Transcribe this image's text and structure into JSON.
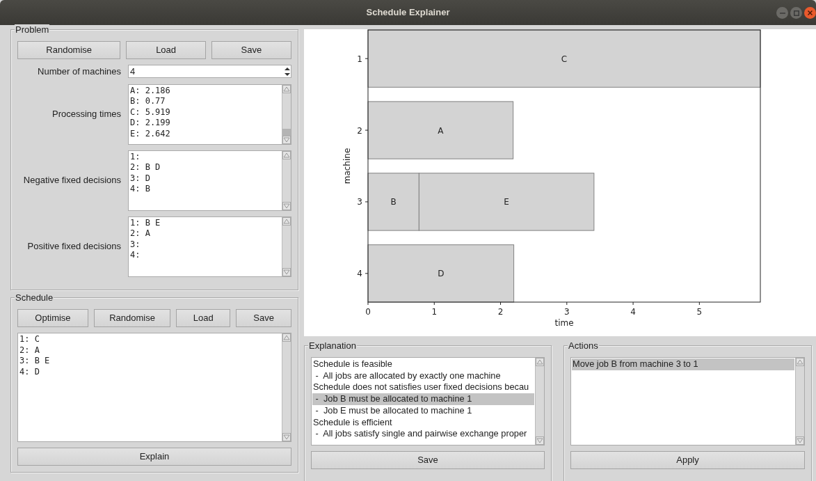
{
  "window": {
    "title": "Schedule Explainer"
  },
  "problem": {
    "title": "Problem",
    "buttons": [
      "Randomise",
      "Load",
      "Save"
    ],
    "machines": {
      "label": "Number of machines",
      "value": "4"
    },
    "fields": [
      {
        "label": "Processing times",
        "lines": [
          "A: 2.186",
          "B: 0.77",
          "C: 5.919",
          "D: 2.199",
          "E: 2.642"
        ]
      },
      {
        "label": "Negative fixed decisions",
        "lines": [
          "1:",
          "2: B D",
          "3: D",
          "4: B"
        ]
      },
      {
        "label": "Positive fixed decisions",
        "lines": [
          "1: B E",
          "2: A",
          "3:",
          "4:"
        ]
      }
    ]
  },
  "schedule": {
    "title": "Schedule",
    "buttons": [
      "Optimise",
      "Randomise",
      "Load",
      "Save"
    ],
    "lines": [
      "1: C",
      "2: A",
      "3: B E",
      "4: D"
    ],
    "action": "Explain"
  },
  "chart": {
    "chart_data": {
      "type": "bar",
      "orientation": "horizontal",
      "stacked": true,
      "xlabel": "time",
      "ylabel": "machine",
      "categories": [
        "1",
        "2",
        "3",
        "4"
      ],
      "xlim": [
        0,
        5.92
      ],
      "xticks": [
        0,
        1,
        2,
        3,
        4,
        5
      ],
      "series": [
        {
          "name": "A",
          "color": "#d3d3d3",
          "values": [
            null,
            2.19,
            null,
            null
          ]
        },
        {
          "name": "B",
          "color": "#d3d3d3",
          "values": [
            null,
            null,
            0.77,
            null
          ]
        },
        {
          "name": "C",
          "color": "#d3d3d3",
          "values": [
            5.92,
            null,
            null,
            null
          ]
        },
        {
          "name": "D",
          "color": "#d3d3d3",
          "values": [
            null,
            null,
            null,
            2.2
          ]
        },
        {
          "name": "E",
          "color": "#d3d3d3",
          "values": [
            null,
            null,
            2.64,
            null
          ]
        }
      ]
    }
  },
  "explanation": {
    "title": "Explanation",
    "items": [
      {
        "text": "Schedule is feasible",
        "selected": false
      },
      {
        "text": " -  All jobs are allocated by exactly one machine",
        "selected": false
      },
      {
        "text": "Schedule does not satisfies user fixed decisions becau",
        "selected": false
      },
      {
        "text": " -  Job B must be allocated to machine 1",
        "selected": true
      },
      {
        "text": " -  Job E must be allocated to machine 1",
        "selected": false
      },
      {
        "text": "Schedule is efficient",
        "selected": false
      },
      {
        "text": " -  All jobs satisfy single and pairwise exchange proper",
        "selected": false
      }
    ],
    "button": "Save"
  },
  "actions": {
    "title": "Actions",
    "items": [
      {
        "text": "Move job B from machine 3 to 1",
        "selected": true
      }
    ],
    "button": "Apply"
  }
}
